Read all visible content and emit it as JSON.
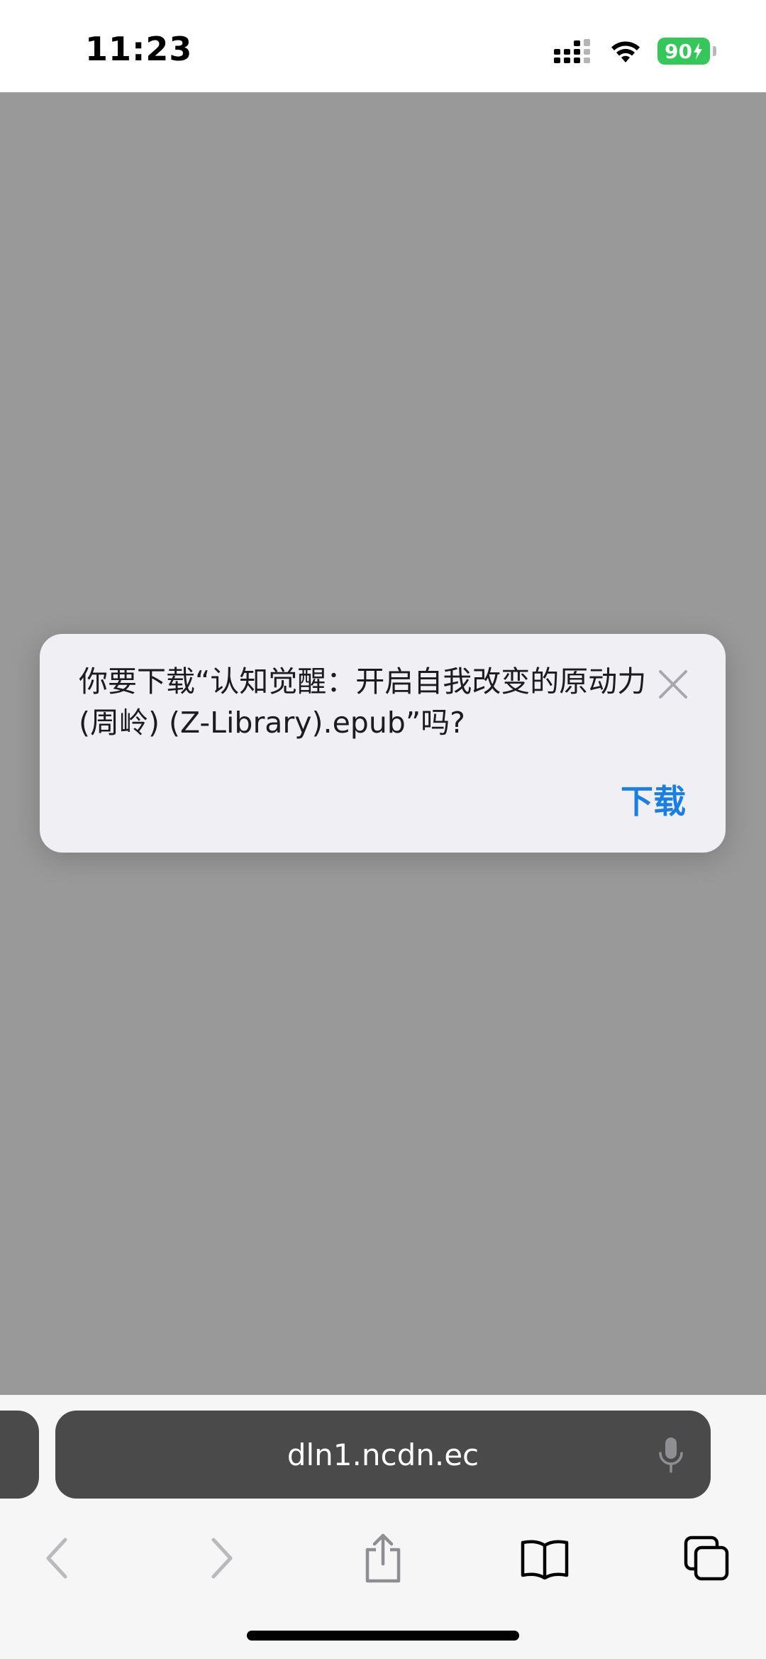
{
  "status_bar": {
    "time": "11:23",
    "battery_level": "90",
    "icons": [
      "cellular-signal-icon",
      "wifi-icon",
      "battery-charging-icon"
    ]
  },
  "alert": {
    "message": "你要下载“认知觉醒：开启自我改变的原动力 (周岭) (Z-Library).epub”吗?",
    "download_label": "下载",
    "close_icon": "close-icon"
  },
  "address_bar": {
    "url": "dln1.ncdn.ec"
  },
  "toolbar": {
    "icons": [
      "back-icon",
      "forward-icon",
      "share-icon",
      "bookmarks-icon",
      "tabs-icon"
    ]
  },
  "colors": {
    "accent": "#1a7fe0",
    "battery": "#34c759",
    "overlay": "#999999",
    "address_bar": "#4a4a4a"
  }
}
